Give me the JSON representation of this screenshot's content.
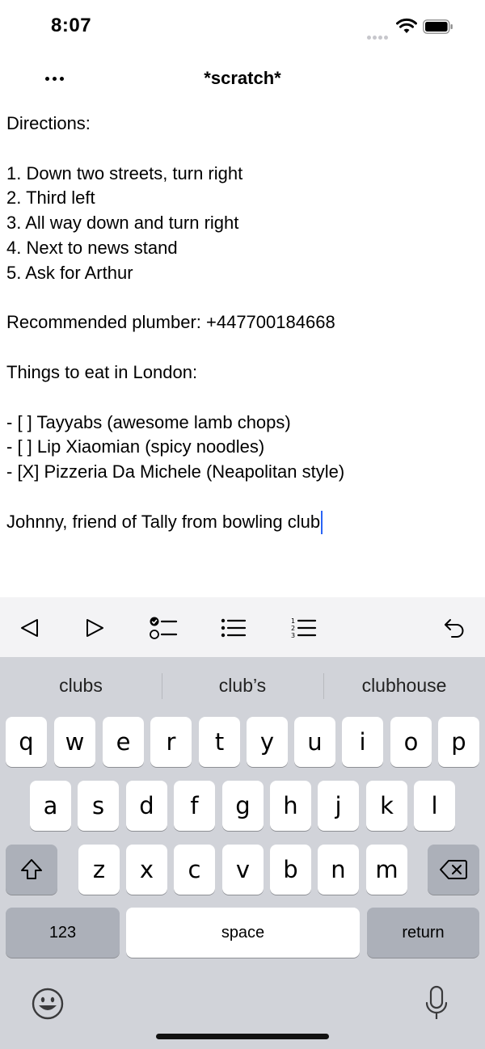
{
  "status": {
    "time": "8:07"
  },
  "nav": {
    "title": "*scratch*"
  },
  "editor": {
    "lines": [
      "Directions:",
      "",
      "1. Down two streets, turn right",
      "2. Third left",
      "3. All way down and turn right",
      "4. Next to news stand",
      "5. Ask for Arthur",
      "",
      "Recommended plumber: +447700184668",
      "",
      "Things to eat in London:",
      "",
      "- [ ] Tayyabs (awesome lamb chops)",
      "- [ ] Lip Xiaomian (spicy noodles)",
      "- [X] Pizzeria Da Michele (Neapolitan style)",
      "",
      "Johnny, friend of Tally from bowling club"
    ],
    "caret_color": "#2a64f6"
  },
  "toolbar": {
    "items": [
      "left-arrow-icon",
      "right-arrow-icon",
      "checklist-icon",
      "bullet-list-icon",
      "numbered-list-icon",
      "undo-icon"
    ]
  },
  "keyboard": {
    "suggestions": [
      "clubs",
      "club’s",
      "clubhouse"
    ],
    "row1": [
      "q",
      "w",
      "e",
      "r",
      "t",
      "y",
      "u",
      "i",
      "o",
      "p"
    ],
    "row2": [
      "a",
      "s",
      "d",
      "f",
      "g",
      "h",
      "j",
      "k",
      "l"
    ],
    "row3": [
      "z",
      "x",
      "c",
      "v",
      "b",
      "n",
      "m"
    ],
    "numbers_label": "123",
    "space_label": "space",
    "return_label": "return",
    "icons": [
      "shift-icon",
      "backspace-icon",
      "emoji-icon",
      "microphone-icon"
    ]
  }
}
